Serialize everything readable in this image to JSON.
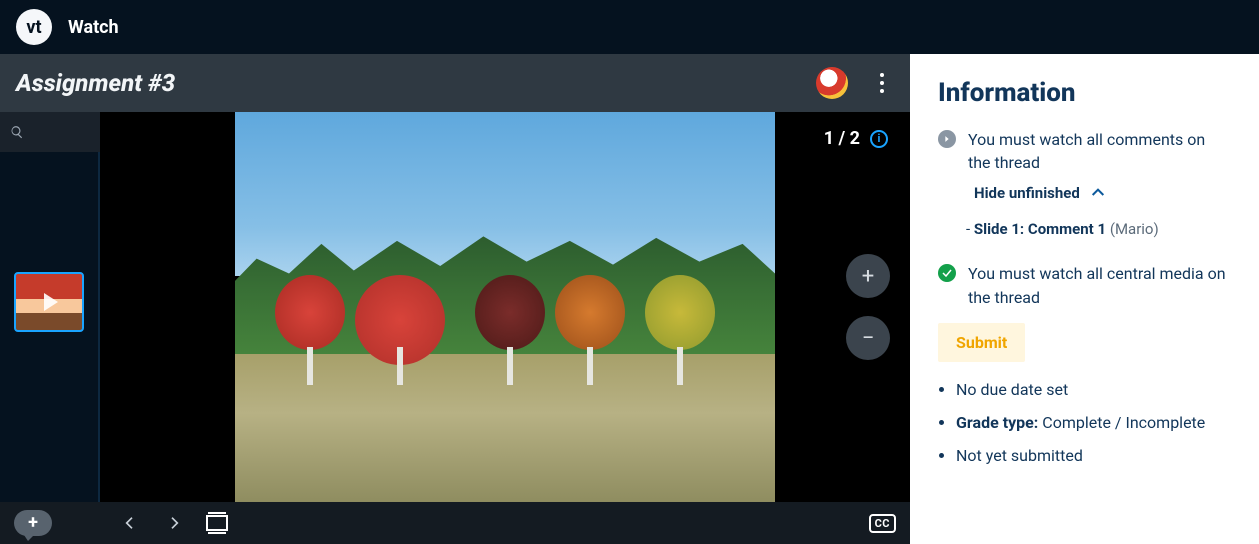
{
  "app": {
    "logo_text": "vt",
    "title": "Watch"
  },
  "subheader": {
    "assignment_title": "Assignment #3"
  },
  "stage": {
    "page_indicator": "1 / 2",
    "info_glyph": "i",
    "zoom_in": "+",
    "zoom_out": "−"
  },
  "bottombar": {
    "comment_plus": "+",
    "cc_label": "CC"
  },
  "info_panel": {
    "heading": "Information",
    "req_comments": "You must watch all comments on the thread",
    "hide_toggle": "Hide unfinished",
    "unfinished_prefix": "- ",
    "unfinished_bold": "Slide 1: Comment 1",
    "unfinished_author": "(Mario)",
    "req_media": "You must watch all central media on the thread",
    "submit_label": "Submit",
    "bullets": {
      "due": "No due date set",
      "grade_label": "Grade type:",
      "grade_value": " Complete / Incomplete",
      "status": "Not yet submitted"
    }
  }
}
